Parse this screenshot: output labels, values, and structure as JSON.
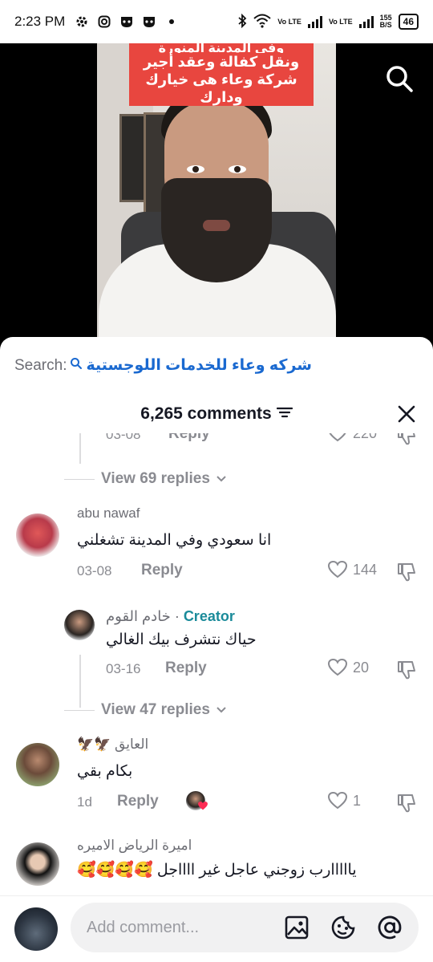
{
  "status_bar": {
    "time": "2:23 PM",
    "lte1": "Vo LTE",
    "lte2": "Vo LTE",
    "speed_value": "155",
    "speed_unit": "B/S",
    "battery": "46"
  },
  "video": {
    "caption_line1": "وفى المدينة المنورة",
    "caption_line2": "ونقل كفالة وعقد أجير",
    "caption_line3": "شركة وعاء هى خيارك ودارك"
  },
  "sheet": {
    "search_label": "Search:",
    "search_query": "شركه وعاء للخدمات اللوجستية",
    "comment_count": "6,265 comments"
  },
  "comments": {
    "partial_date": "03-08",
    "partial_reply": "Reply",
    "partial_likes": "220",
    "view_replies_1": "View 69 replies",
    "c1": {
      "username": "abu nawaf",
      "text": "انا سعودي وفي المدينة تشغلني",
      "date": "03-08",
      "reply_label": "Reply",
      "likes": "144"
    },
    "r1": {
      "username": "خادم القوم",
      "separator": " · ",
      "badge": "Creator",
      "text": "حياك نتشرف بيك الغالي",
      "date": "03-16",
      "reply_label": "Reply",
      "likes": "20"
    },
    "view_replies_2": "View 47 replies",
    "c2": {
      "username": "العايق 🦅🦅",
      "text": "بكام بقي",
      "date": "1d",
      "reply_label": "Reply",
      "likes": "1"
    },
    "c3": {
      "username": "اميرة الرياض الاميره",
      "text": "يااااارب زوجني عاجل غير ااااجل 🥰🥰🥰🥰"
    }
  },
  "input": {
    "placeholder": "Add comment..."
  },
  "icons": {
    "image": "image-icon",
    "emoji": "emoji-icon",
    "mention": "at-icon",
    "close": "close-icon",
    "search": "search-icon",
    "heart": "heart-icon",
    "dislike": "dislike-icon",
    "filter": "filter-icon"
  }
}
